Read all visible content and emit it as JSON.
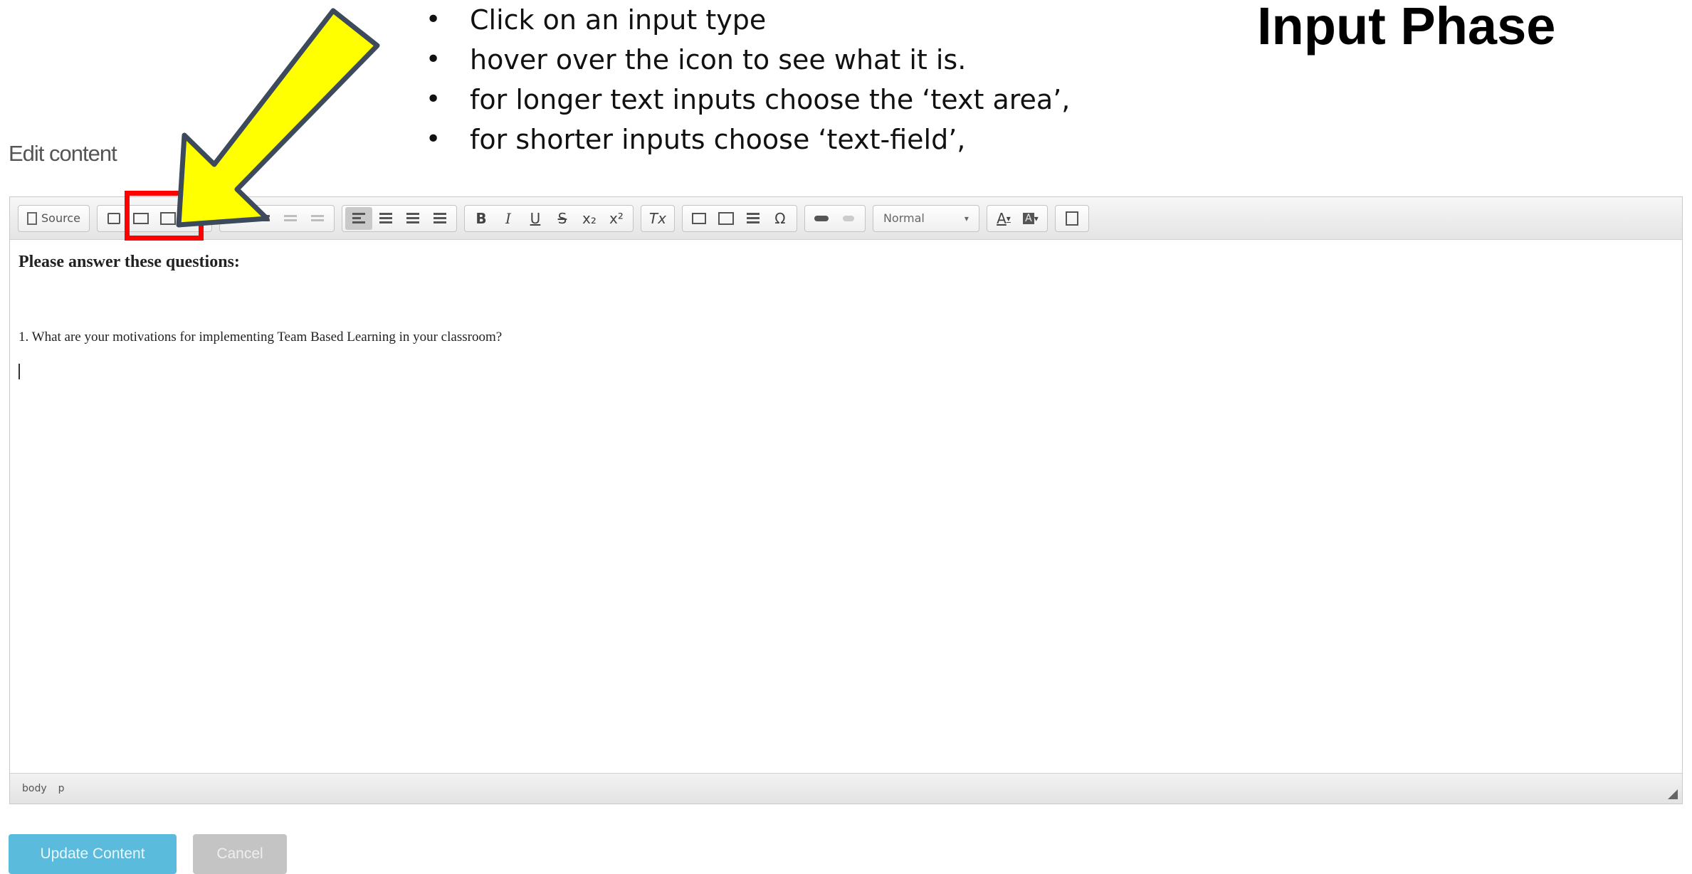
{
  "slide": {
    "title": "Input Phase",
    "bullets": [
      "Click on an input type",
      "hover over the icon to see what it is.",
      "for longer text inputs choose the ‘text area’,",
      "for shorter inputs choose ‘text-field’,"
    ]
  },
  "editor": {
    "label": "Edit content",
    "toolbar": {
      "source_label": "Source",
      "format_select": "Normal",
      "bold": "B",
      "italic": "I",
      "underline": "U",
      "strike": "S",
      "subscript": "x₂",
      "superscript": "x²",
      "remove_format": "Tx",
      "special_char": "Ω",
      "text_color": "A",
      "bg_color": "A"
    },
    "content": {
      "heading": "Please answer these questions:",
      "question": "1. What are your motivations for implementing Team Based Learning in your classroom?"
    },
    "statusbar": {
      "path": [
        "body",
        "p"
      ]
    }
  },
  "buttons": {
    "update": "Update Content",
    "cancel": "Cancel"
  },
  "annotation": {
    "arrow_color": "#ffff00",
    "box_color": "#ff0000"
  }
}
